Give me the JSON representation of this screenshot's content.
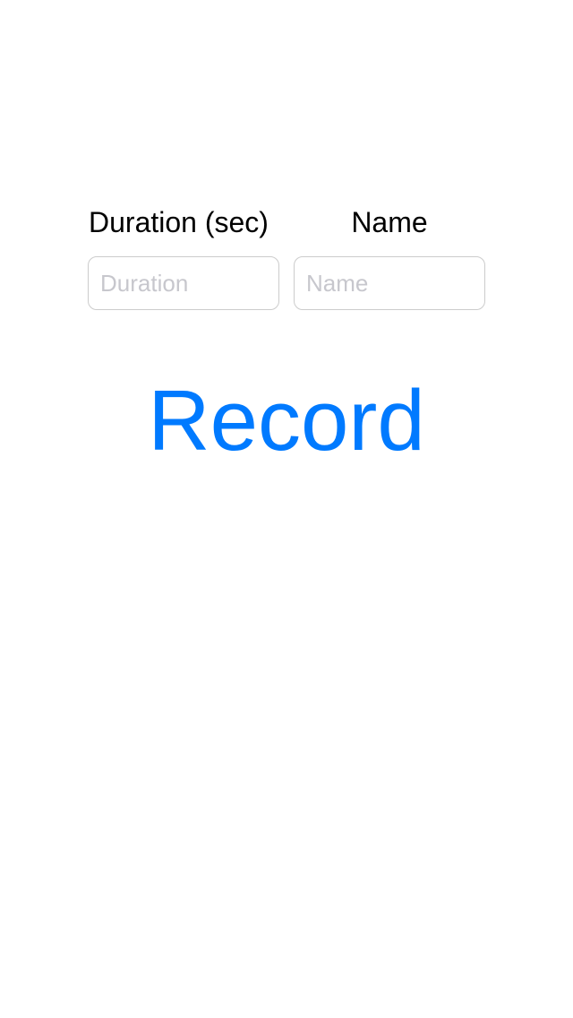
{
  "form": {
    "duration_label": "Duration (sec)",
    "name_label": "Name",
    "duration_placeholder": "Duration",
    "name_placeholder": "Name",
    "duration_value": "",
    "name_value": ""
  },
  "actions": {
    "record_label": "Record"
  },
  "colors": {
    "accent": "#007aff",
    "placeholder": "#c7c7cd",
    "field_border": "#cccccc",
    "label_text": "#000000",
    "background": "#ffffff"
  }
}
